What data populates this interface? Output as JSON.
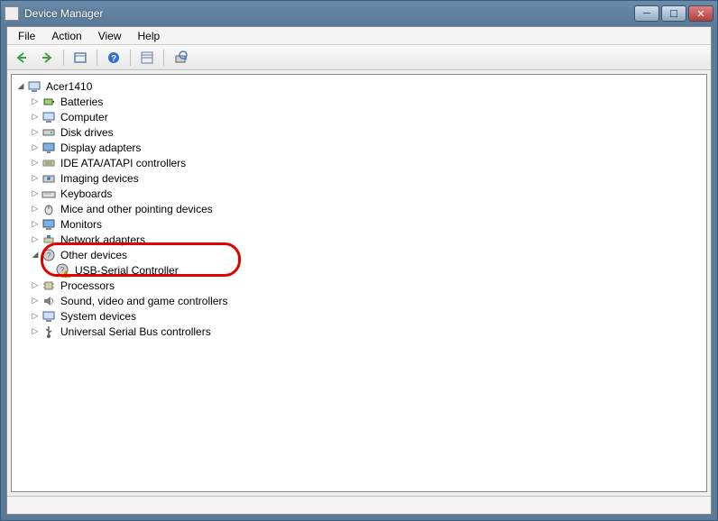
{
  "window": {
    "title": "Device Manager"
  },
  "menu": {
    "file": "File",
    "action": "Action",
    "view": "View",
    "help": "Help"
  },
  "toolbar": {
    "back": "Back",
    "forward": "Forward",
    "show_hidden": "Show hidden devices",
    "help_btn": "Help",
    "view_btn": "View",
    "scan": "Scan for hardware changes"
  },
  "tree": {
    "root": "Acer1410",
    "items": [
      {
        "label": "Batteries",
        "icon": "battery"
      },
      {
        "label": "Computer",
        "icon": "computer"
      },
      {
        "label": "Disk drives",
        "icon": "disk"
      },
      {
        "label": "Display adapters",
        "icon": "display"
      },
      {
        "label": "IDE ATA/ATAPI controllers",
        "icon": "ide"
      },
      {
        "label": "Imaging devices",
        "icon": "imaging"
      },
      {
        "label": "Keyboards",
        "icon": "keyboard"
      },
      {
        "label": "Mice and other pointing devices",
        "icon": "mouse"
      },
      {
        "label": "Monitors",
        "icon": "monitor"
      },
      {
        "label": "Network adapters",
        "icon": "network"
      }
    ],
    "other_devices": {
      "label": "Other devices",
      "children": [
        {
          "label": "USB-Serial Controller",
          "icon": "unknown_warning"
        }
      ]
    },
    "after": [
      {
        "label": "Processors",
        "icon": "processor"
      },
      {
        "label": "Sound, video and game controllers",
        "icon": "sound"
      },
      {
        "label": "System devices",
        "icon": "system"
      },
      {
        "label": "Universal Serial Bus controllers",
        "icon": "usb"
      }
    ]
  }
}
